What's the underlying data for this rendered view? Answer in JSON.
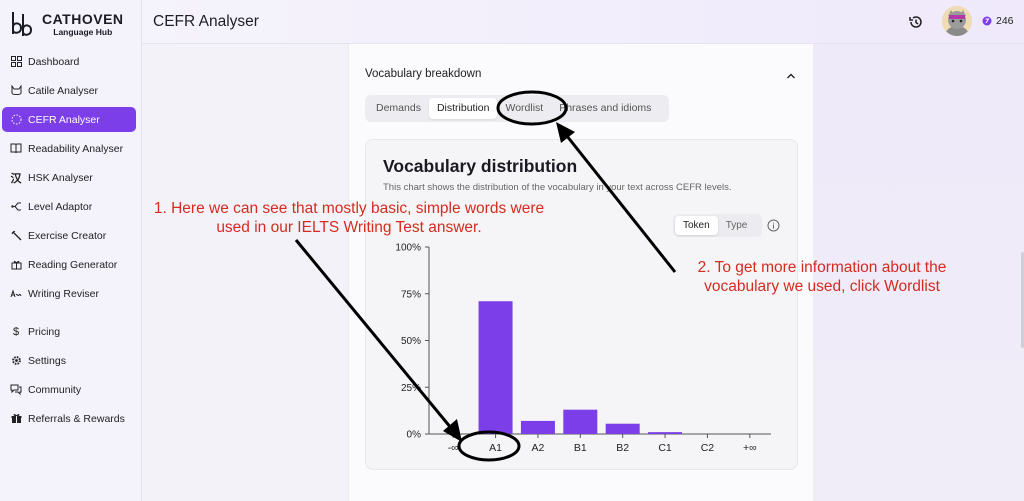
{
  "brand": {
    "title": "CATHOVEN",
    "subtitle": "Language Hub"
  },
  "sidebar": {
    "items": [
      {
        "label": "Dashboard",
        "icon": "grid-icon"
      },
      {
        "label": "Catile Analyser",
        "icon": "cat-icon"
      },
      {
        "label": "CEFR Analyser",
        "icon": "dotted-circle-icon",
        "active": true
      },
      {
        "label": "Readability Analyser",
        "icon": "book-icon"
      },
      {
        "label": "HSK Analyser",
        "icon": "hanzi-icon"
      },
      {
        "label": "Level Adaptor",
        "icon": "branch-icon"
      },
      {
        "label": "Exercise Creator",
        "icon": "wand-icon"
      },
      {
        "label": "Reading Generator",
        "icon": "gift-box-icon"
      },
      {
        "label": "Writing Reviser",
        "icon": "signature-icon"
      }
    ],
    "bottom_items": [
      {
        "label": "Pricing",
        "icon": "dollar-icon"
      },
      {
        "label": "Settings",
        "icon": "gear-icon"
      },
      {
        "label": "Community",
        "icon": "chat-icon"
      },
      {
        "label": "Referrals & Rewards",
        "icon": "gift-icon"
      }
    ]
  },
  "header": {
    "title": "CEFR Analyser",
    "credits": "246"
  },
  "section": {
    "title": "Vocabulary breakdown",
    "tabs": [
      "Demands",
      "Distribution",
      "Wordlist",
      "Phrases and idioms"
    ],
    "active_tab": "Distribution"
  },
  "card": {
    "title": "Vocabulary distribution",
    "description": "This chart shows the distribution of the vocabulary in your text across CEFR levels.",
    "toggle": [
      "Token",
      "Type"
    ],
    "active_toggle": "Token"
  },
  "chart_data": {
    "type": "bar",
    "categories": [
      "-∞",
      "A1",
      "A2",
      "B1",
      "B2",
      "C1",
      "C2",
      "+∞"
    ],
    "values": [
      0,
      71,
      7,
      13,
      5.5,
      1,
      0,
      0
    ],
    "yticks": [
      "100%",
      "75%",
      "50%",
      "25%",
      "0%"
    ],
    "ylim": [
      0,
      100
    ],
    "color": "#7b3ee8",
    "grid": false
  },
  "annotations": {
    "note1": [
      "1. Here we can see that mostly basic, simple words were",
      "used in our IELTS Writing Test answer."
    ],
    "note2": [
      "2. To get more information about the",
      "vocabulary we used, click Wordlist"
    ],
    "color": "#d52b20"
  }
}
